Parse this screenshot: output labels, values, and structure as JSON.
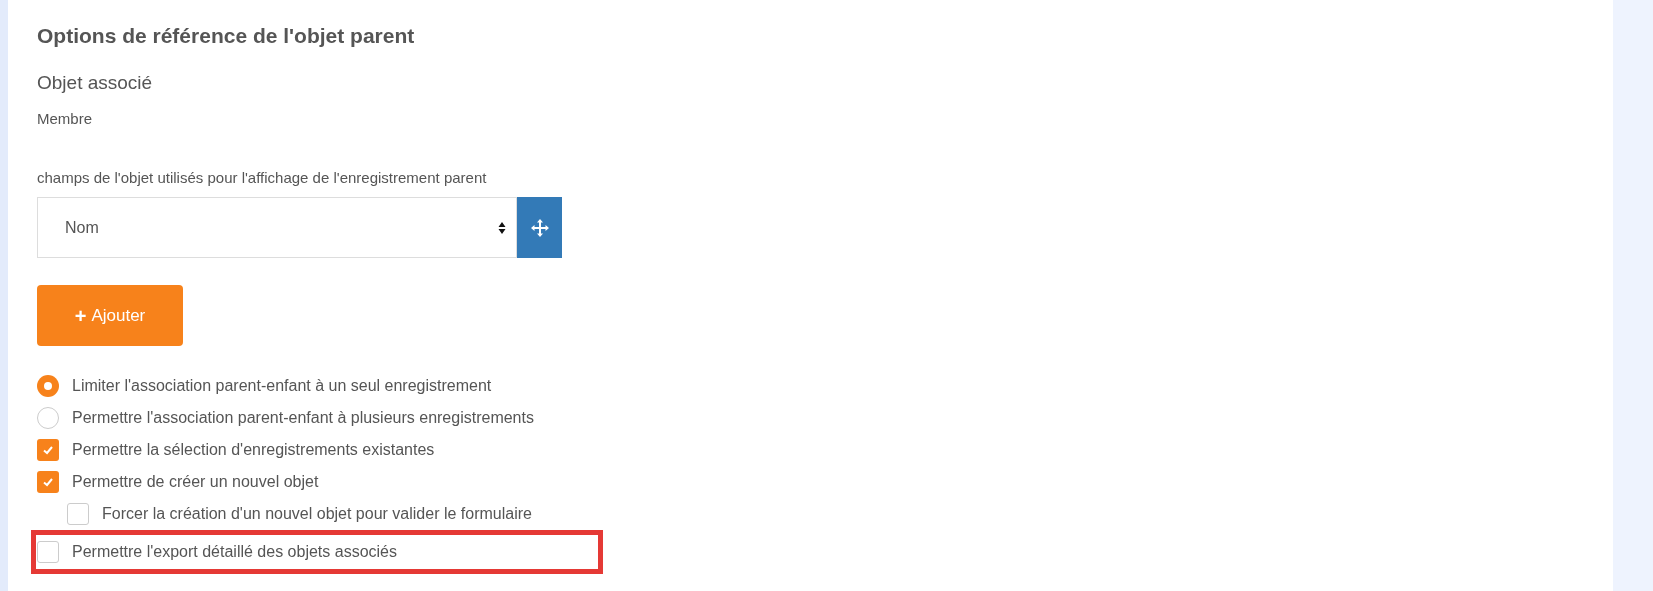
{
  "section": {
    "title": "Options de référence de l'objet parent",
    "subtitle": "Objet associé",
    "object_value": "Membre",
    "fields_label": "champs de l'objet utilisés pour l'affichage de l'enregistrement parent"
  },
  "field_select": {
    "value": "Nom"
  },
  "add_button": {
    "icon": "+",
    "label": "Ajouter"
  },
  "options": [
    {
      "kind": "radio",
      "label": "Limiter l'association parent-enfant à un seul enregistrement",
      "selected": true,
      "highlighted": false
    },
    {
      "kind": "radio",
      "label": "Permettre l'association parent-enfant à plusieurs enregistrements",
      "selected": false,
      "highlighted": false
    },
    {
      "kind": "checkbox",
      "label": "Permettre la sélection d'enregistrements existantes",
      "checked": true,
      "highlighted": false
    },
    {
      "kind": "checkbox",
      "label": "Permettre de créer un nouvel objet",
      "checked": true,
      "highlighted": false,
      "children": [
        {
          "kind": "checkbox",
          "label": "Forcer la création d'un nouvel objet pour valider le formulaire",
          "checked": false,
          "highlighted": false
        }
      ]
    },
    {
      "kind": "checkbox",
      "label": "Permettre l'export détaillé des objets associés",
      "checked": false,
      "highlighted": true
    }
  ]
}
